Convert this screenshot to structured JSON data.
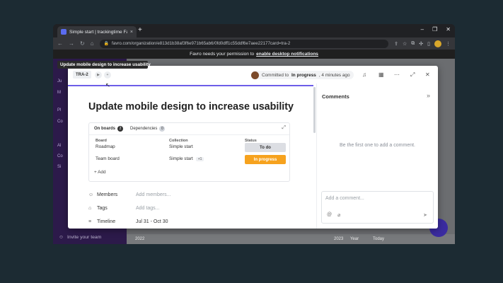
{
  "browser": {
    "tab_title": "Simple start | trackingtime Favro",
    "tab_close": "×",
    "new_tab": "+",
    "window_controls": [
      "–",
      "❐",
      "✕"
    ],
    "url": "favro.com/organization/e813d1b38af3f6e971b65ab6/0fd0dff1c55ddf6e7aee22177card=tra-2",
    "notification": "Favro needs your permission to",
    "notification_link": "enable desktop notifications"
  },
  "tooltip": "Update mobile design to increase usability",
  "card": {
    "id": "TRA-2",
    "commit_text": "Committed to",
    "commit_status": "In progress",
    "commit_time": ", 4 minutes ago",
    "title": "Update mobile design to increase usability",
    "tabs": [
      {
        "label": "On boards",
        "count": "2"
      },
      {
        "label": "Dependencies",
        "count": "0"
      }
    ],
    "table_headers": [
      "Board",
      "Collection",
      "Status"
    ],
    "rows": [
      {
        "board": "Roadmap",
        "collection": "Simple start",
        "extra": "",
        "status": "To do"
      },
      {
        "board": "Team board",
        "collection": "Simple start",
        "extra": "+1",
        "status": "In progress"
      }
    ],
    "add_label": "+ Add",
    "fields": [
      {
        "label": "Members",
        "value": "Add members..."
      },
      {
        "label": "Tags",
        "value": "Add tags..."
      },
      {
        "label": "Timeline",
        "value": "Jul 31 - Oct 30"
      }
    ]
  },
  "comments": {
    "header": "Comments",
    "empty": "Be the first one to add a comment.",
    "placeholder": "Add a comment..."
  },
  "sidebar": {
    "invite": "Invite your team",
    "fragments": [
      "Ju",
      "M",
      "Pl",
      "Co",
      "Al",
      "Co",
      "Si"
    ]
  },
  "bottom": {
    "year_left": "2022",
    "year_right": "2023",
    "year_select": "Year",
    "today": "Today"
  },
  "colors": {
    "accent": "#6d5ee8",
    "in_progress": "#f6a21e",
    "sidebar": "#2c1a4a"
  }
}
